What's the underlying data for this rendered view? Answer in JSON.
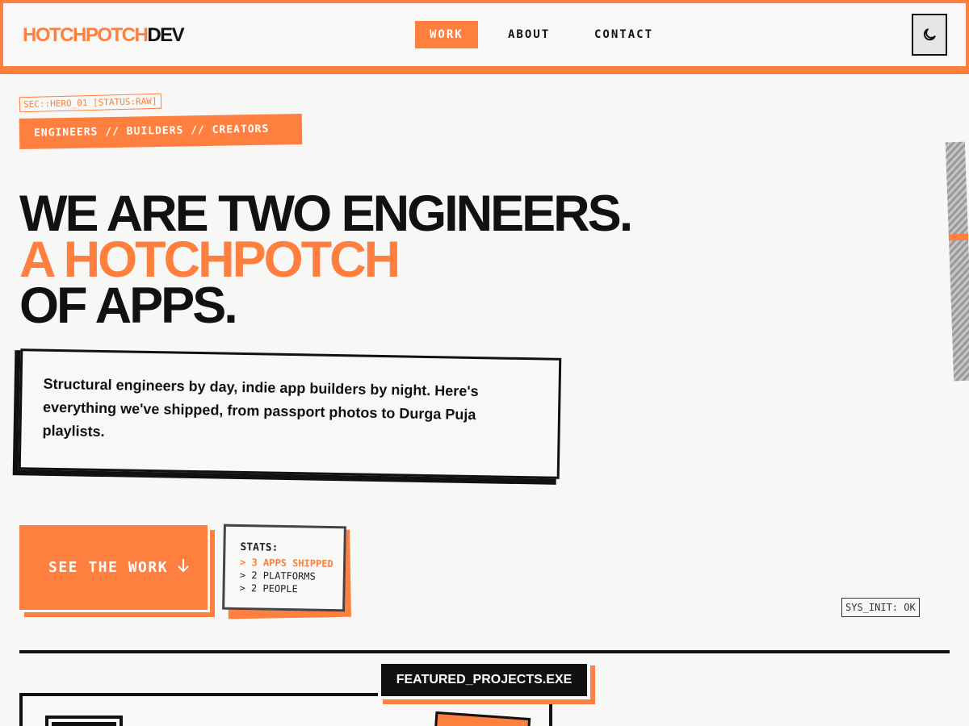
{
  "nav": {
    "logo_part1": "HOTCHPOTCH",
    "logo_part2": "DEV",
    "links": [
      {
        "label": "WORK"
      },
      {
        "label": "ABOUT"
      },
      {
        "label": "CONTACT"
      }
    ],
    "theme_icon": "moon-icon"
  },
  "hero": {
    "section_tag": "SEC::HERO_01 [STATUS:RAW]",
    "role_tag": "ENGINEERS // BUILDERS // CREATORS",
    "headline_line1": "WE ARE TWO ENGINEERS.",
    "headline_line2": "A HOTCHPOTCH",
    "headline_line3": "OF APPS.",
    "description": "Structural engineers by day, indie app builders by night. Here's everything we've shipped, from passport photos to Durga Puja playlists.",
    "cta_label": "SEE THE WORK",
    "cta_icon": "arrow-down-icon",
    "stats": {
      "title": "STATS:",
      "lines": [
        "> 3 APPS SHIPPED",
        "> 2 PLATFORMS",
        "> 2 PEOPLE"
      ]
    },
    "sys_status": "SYS_INIT: OK"
  },
  "featured": {
    "title": "FEATURED_PROJECTS.EXE"
  },
  "colors": {
    "accent": "#ff7f3e",
    "ink": "#111111",
    "background": "#f7f7f6"
  }
}
